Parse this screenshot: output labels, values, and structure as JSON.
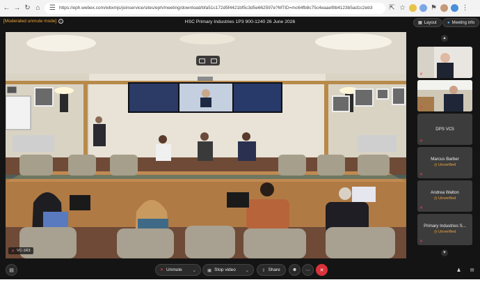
{
  "browser": {
    "url": "https://eph.webex.com/wbxmjs/joinservice/sites/eph/meeting/download/bfa51c172d5f4421bf5c3d5e662597e?MTID=mc64fb8c75c4eaaef8b4123b5ad1c2eb3",
    "icons": [
      "back-icon",
      "forward-icon",
      "reload-icon",
      "home-icon",
      "tune-icon",
      "share-icon",
      "star-icon",
      "extensions-icon",
      "profile-icon"
    ]
  },
  "meeting": {
    "mode_label": "[Moderated unmute mode]",
    "title": "HSC Primary Industries 1P3 900-1240 26 June 2026",
    "layout_label": "Layout",
    "info_label": "Meeting info"
  },
  "stage": {
    "name": "VC-1R3"
  },
  "participants": [
    {
      "name": "",
      "status": "",
      "video": true
    },
    {
      "name": "",
      "status": "",
      "video": true
    },
    {
      "name": "DPS VC5",
      "status": "",
      "video": false
    },
    {
      "name": "Marcus Barber",
      "status": "Unverified",
      "video": false
    },
    {
      "name": "Andrea Walton",
      "status": "Unverified",
      "video": false
    },
    {
      "name": "Primary Industries S...",
      "status": "Unverified",
      "video": false
    }
  ],
  "controls": {
    "unmute_label": "Unmute",
    "stop_video_label": "Stop video",
    "share_label": "Share"
  },
  "colors": {
    "accent_orange": "#f0a63a",
    "end_red": "#d9323a",
    "app_bg": "#141414"
  }
}
